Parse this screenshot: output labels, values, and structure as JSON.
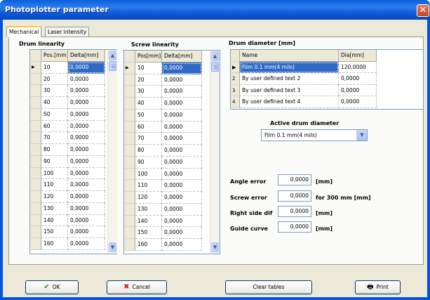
{
  "window": {
    "title": "Photoplotter parameter",
    "close_glyph": "✕"
  },
  "tabs": [
    {
      "label": "Mechanical",
      "active": true
    },
    {
      "label": "Laser intensity",
      "active": false
    }
  ],
  "drum_linearity": {
    "title": "Drum linearity",
    "columns": [
      "Pos.[mm]",
      "Delta[mm]"
    ],
    "rows": [
      [
        "10",
        "0,0000"
      ],
      [
        "20",
        "0,0000"
      ],
      [
        "30",
        "0,0000"
      ],
      [
        "40",
        "0,0000"
      ],
      [
        "50",
        "0,0000"
      ],
      [
        "60",
        "0,0000"
      ],
      [
        "70",
        "0,0000"
      ],
      [
        "80",
        "0,0000"
      ],
      [
        "90",
        "0,0000"
      ],
      [
        "100",
        "0,0000"
      ],
      [
        "110",
        "0,0000"
      ],
      [
        "120",
        "0,0000"
      ],
      [
        "130",
        "0,0000"
      ],
      [
        "140",
        "0,0000"
      ],
      [
        "150",
        "0,0000"
      ],
      [
        "160",
        "0,0000"
      ]
    ]
  },
  "screw_linearity": {
    "title": "Screw linearity",
    "columns": [
      "Pos[mm]",
      "Delta[mm]"
    ],
    "rows": [
      [
        "10",
        "0,0000"
      ],
      [
        "20",
        "0,0000"
      ],
      [
        "30",
        "0,0000"
      ],
      [
        "40",
        "0,0000"
      ],
      [
        "50",
        "0,0000"
      ],
      [
        "60",
        "0,0000"
      ],
      [
        "70",
        "0,0000"
      ],
      [
        "80",
        "0,0000"
      ],
      [
        "90",
        "0,0000"
      ],
      [
        "100",
        "0,0000"
      ],
      [
        "110",
        "0,0000"
      ],
      [
        "120",
        "0,0000"
      ],
      [
        "130",
        "0,0000"
      ],
      [
        "140",
        "0,0000"
      ],
      [
        "150",
        "0,0000"
      ],
      [
        "160",
        "0,0000"
      ]
    ]
  },
  "drum_diameter": {
    "title": "Drum diameter  [mm]",
    "columns": [
      "Name",
      "Dia[mm]"
    ],
    "rows": [
      {
        "index": "",
        "name": "Film 0.1 mm(4 mils)",
        "dia": "120,0000"
      },
      {
        "index": "2",
        "name": "By user defined text 2",
        "dia": "0,0000"
      },
      {
        "index": "3",
        "name": "By user defined text 3",
        "dia": "0,0000"
      },
      {
        "index": "4",
        "name": "By user defined text 4",
        "dia": "0,0000"
      }
    ]
  },
  "active_drum": {
    "label": "Active drum diameter",
    "selected": "Film 0.1 mm(4 mils)"
  },
  "errors": [
    {
      "label": "Angle error",
      "value": "0,0000",
      "unit": "[mm]"
    },
    {
      "label": "Screw error",
      "value": "0,0000",
      "unit": "for 300 mm [mm]"
    },
    {
      "label": "Right side dif",
      "value": "0,0000",
      "unit": "[mm]"
    },
    {
      "label": "Guide curve",
      "value": "0,0000",
      "unit": "[mm]"
    }
  ],
  "buttons": {
    "ok": "OK",
    "cancel": "Cancel",
    "clear": "Clear tables",
    "print": "Print"
  },
  "icons": {
    "row_pointer": "▶",
    "scroll_up": "▲",
    "scroll_down": "▼",
    "dropdown": "▼",
    "ok": "✔",
    "cancel": "✖",
    "print": "🖶"
  },
  "colors": {
    "selection": "#316ac5",
    "title_bar": "#0a5fd8",
    "dialog_bg": "#ece9d8",
    "ok_check": "#2e8b2e",
    "cancel_x": "#c0281e"
  }
}
